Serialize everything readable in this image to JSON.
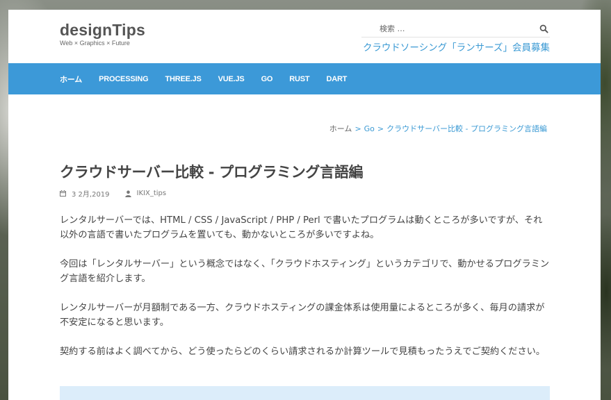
{
  "site": {
    "logo": "designTips",
    "tagline": "Web × Graphics × Future"
  },
  "search": {
    "placeholder": "検索 …"
  },
  "promo_link": "クラウドソーシング「ランサーズ」会員募集",
  "nav": {
    "items": [
      "ホーム",
      "PROCESSING",
      "THREE.JS",
      "VUE.JS",
      "GO",
      "RUST",
      "DART"
    ]
  },
  "breadcrumb": {
    "home": "ホーム",
    "sep": ">",
    "category": "Go",
    "current": "クラウドサーバー比較 - プログラミング言語編"
  },
  "article": {
    "title": "クラウドサーバー比較 - プログラミング言語編",
    "date": "3 2月,2019",
    "author": "IKIX_tips",
    "paragraphs": [
      "レンタルサーバーでは、HTML / CSS / JavaScript / PHP / Perl で書いたプログラムは動くところが多いですが、それ以外の言語で書いたプログラムを置いても、動かないところが多いですよね。",
      "今回は「レンタルサーバー」という概念ではなく、「クラウドホスティング」というカテゴリで、動かせるプログラミング言語を紹介します。",
      "レンタルサーバーが月額制である一方、クラウドホスティングの課金体系は使用量によるところが多く、毎月の請求が不安定になると思います。",
      "契約する前はよく調べてから、どう使ったらどのくらい請求されるか計算ツールで見積もったうえでご契約ください。"
    ]
  },
  "colors": {
    "accent": "#3c99d8",
    "notice_bg": "#dcedfa"
  }
}
